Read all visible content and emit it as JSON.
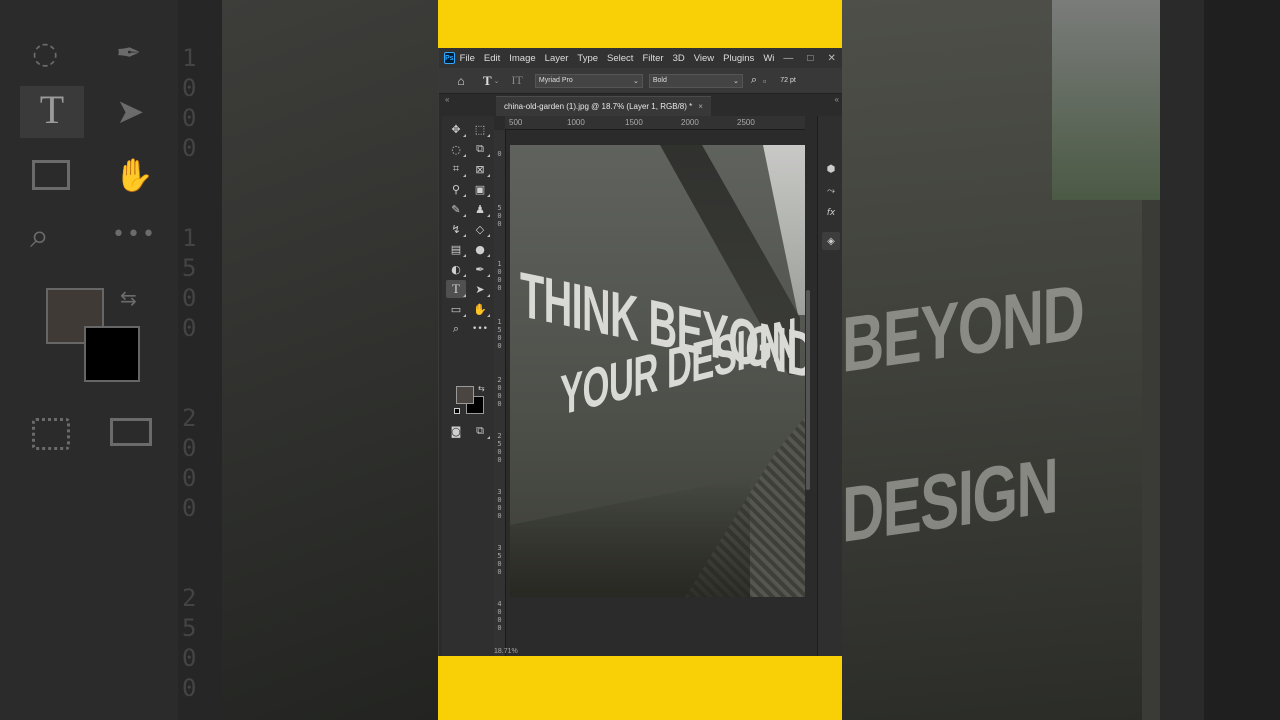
{
  "menu": {
    "logo": "Ps",
    "items": [
      "File",
      "Edit",
      "Image",
      "Layer",
      "Type",
      "Select",
      "Filter",
      "3D",
      "View",
      "Plugins",
      "Wi"
    ],
    "window_controls": [
      "—",
      "□",
      "✕"
    ]
  },
  "options": {
    "home_icon": "home-icon",
    "type_tool_glyph": "T",
    "orient_glyph": "IT",
    "font_family": "Myriad Pro",
    "font_style": "Bold",
    "font_size": "72 pt"
  },
  "document": {
    "tab_title": "china-old-garden (1).jpg @ 18.7% (Layer 1, RGB/8) *",
    "close": "×"
  },
  "ruler": {
    "top_ticks": [
      "500",
      "1000",
      "1500",
      "2000",
      "2500"
    ],
    "left_ticks": [
      "0",
      "500",
      "1000",
      "1500",
      "2000",
      "2500",
      "3000",
      "3500",
      "4000"
    ]
  },
  "artwork": {
    "line1": "THINK BEYOND",
    "line2": "YOUR DESIGN"
  },
  "colors": {
    "foreground": "#4a4541",
    "background": "#000000",
    "accent_frame": "#f9d005"
  },
  "status": {
    "zoom": "18.71%"
  },
  "background_blur": {
    "left_digits": [
      "1",
      "0",
      "0",
      "0",
      "1",
      "5",
      "0",
      "0",
      "2",
      "0",
      "0",
      "0",
      "2",
      "5",
      "0",
      "0"
    ],
    "right_text_1": "BEYOND",
    "right_text_2": "DESIGN"
  }
}
